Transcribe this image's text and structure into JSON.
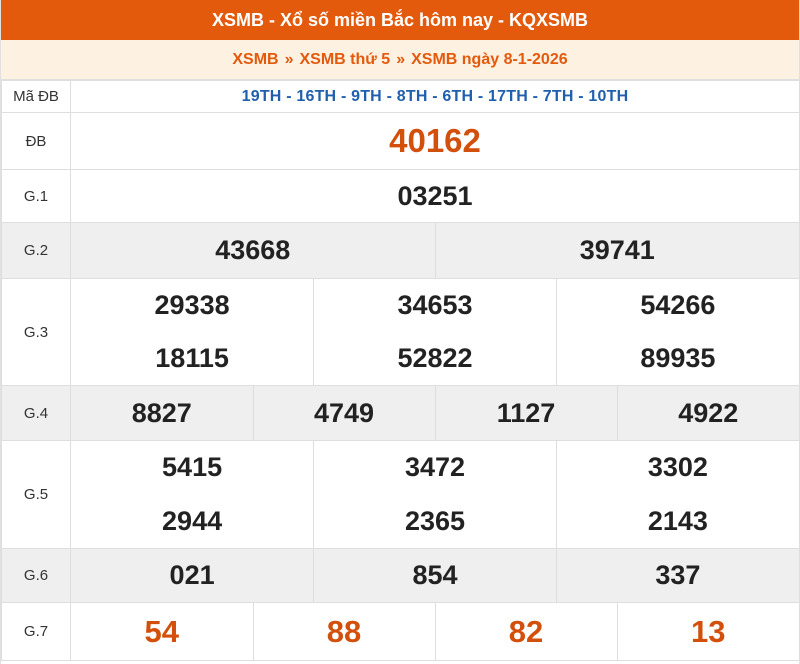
{
  "header": {
    "title": "XSMB - Xổ số miền Bắc hôm nay - KQXSMB"
  },
  "breadcrumb": {
    "items": [
      "XSMB",
      "XSMB thứ 5",
      "XSMB ngày 8-1-2026"
    ],
    "separator": "»"
  },
  "results": {
    "ma_db": {
      "label": "Mã ĐB",
      "codes": "19TH - 16TH - 9TH - 8TH - 6TH - 17TH - 7TH - 10TH"
    },
    "db": {
      "label": "ĐB",
      "numbers": [
        "40162"
      ]
    },
    "g1": {
      "label": "G.1",
      "numbers": [
        "03251"
      ]
    },
    "g2": {
      "label": "G.2",
      "numbers": [
        "43668",
        "39741"
      ]
    },
    "g3": {
      "label": "G.3",
      "numbers": [
        "29338",
        "34653",
        "54266",
        "18115",
        "52822",
        "89935"
      ]
    },
    "g4": {
      "label": "G.4",
      "numbers": [
        "8827",
        "4749",
        "1127",
        "4922"
      ]
    },
    "g5": {
      "label": "G.5",
      "numbers": [
        "5415",
        "3472",
        "3302",
        "2944",
        "2365",
        "2143"
      ]
    },
    "g6": {
      "label": "G.6",
      "numbers": [
        "021",
        "854",
        "337"
      ]
    },
    "g7": {
      "label": "G.7",
      "numbers": [
        "54",
        "88",
        "82",
        "13"
      ]
    }
  },
  "colors": {
    "header_bg": "#e45a0c",
    "breadcrumb_bg": "#fdf1e2",
    "accent_orange": "#d2500c",
    "code_blue": "#1f5fae",
    "row_gray": "#efefef"
  }
}
